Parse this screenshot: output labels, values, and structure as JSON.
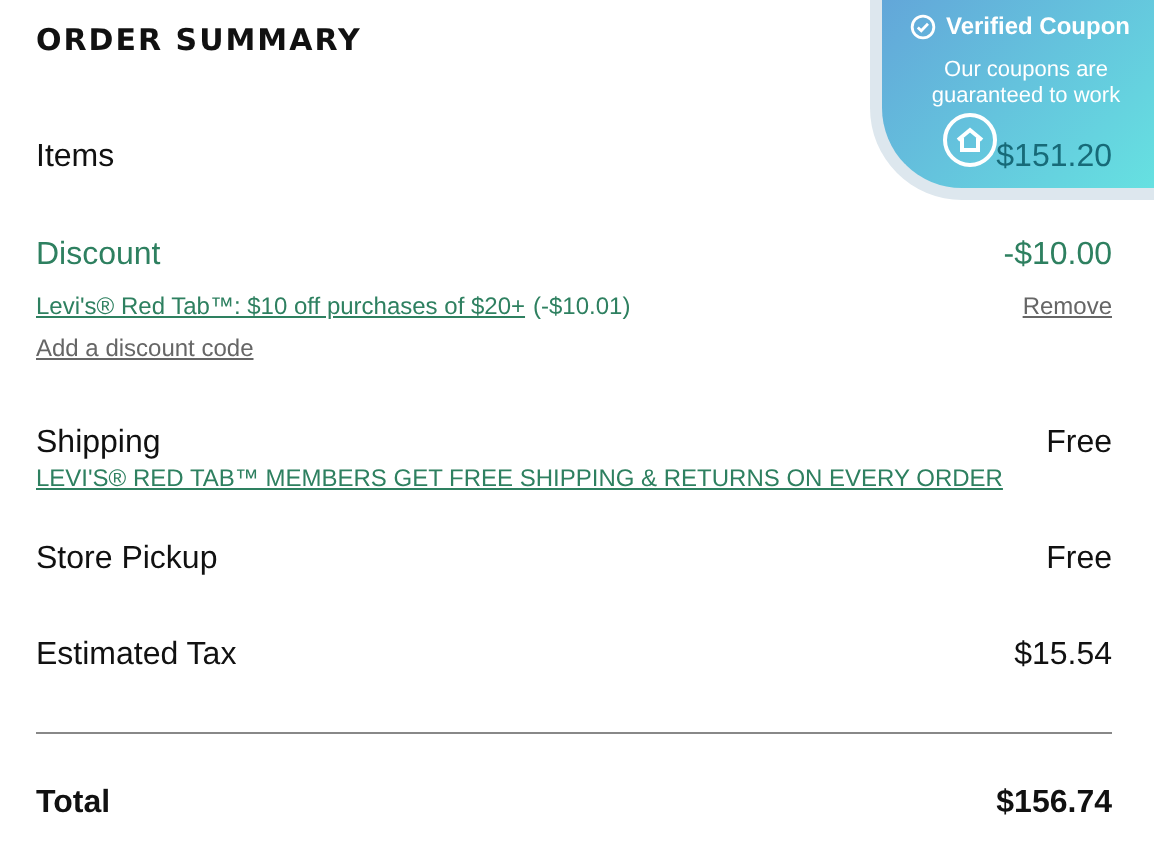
{
  "title": "ORDER SUMMARY",
  "items": {
    "label": "Items",
    "value": "$151.20"
  },
  "discount": {
    "label": "Discount",
    "value": "-$10.00",
    "promo_link": "Levi's® Red Tab™: $10 off purchases of $20+",
    "promo_amount": "(-$10.01)",
    "remove": "Remove",
    "add_code": "Add a discount code"
  },
  "shipping": {
    "label": "Shipping",
    "value": "Free",
    "note": "LEVI'S® RED TAB™ MEMBERS GET FREE SHIPPING & RETURNS ON EVERY ORDER"
  },
  "rows": [
    {
      "label": "Store Pickup",
      "value": "Free"
    },
    {
      "label": "Estimated Tax",
      "value": "$15.54"
    }
  ],
  "total": {
    "label": "Total",
    "value": "$156.74"
  },
  "coupon_badge": {
    "title": "Verified Coupon",
    "text": "Our coupons are guaranteed to work"
  }
}
